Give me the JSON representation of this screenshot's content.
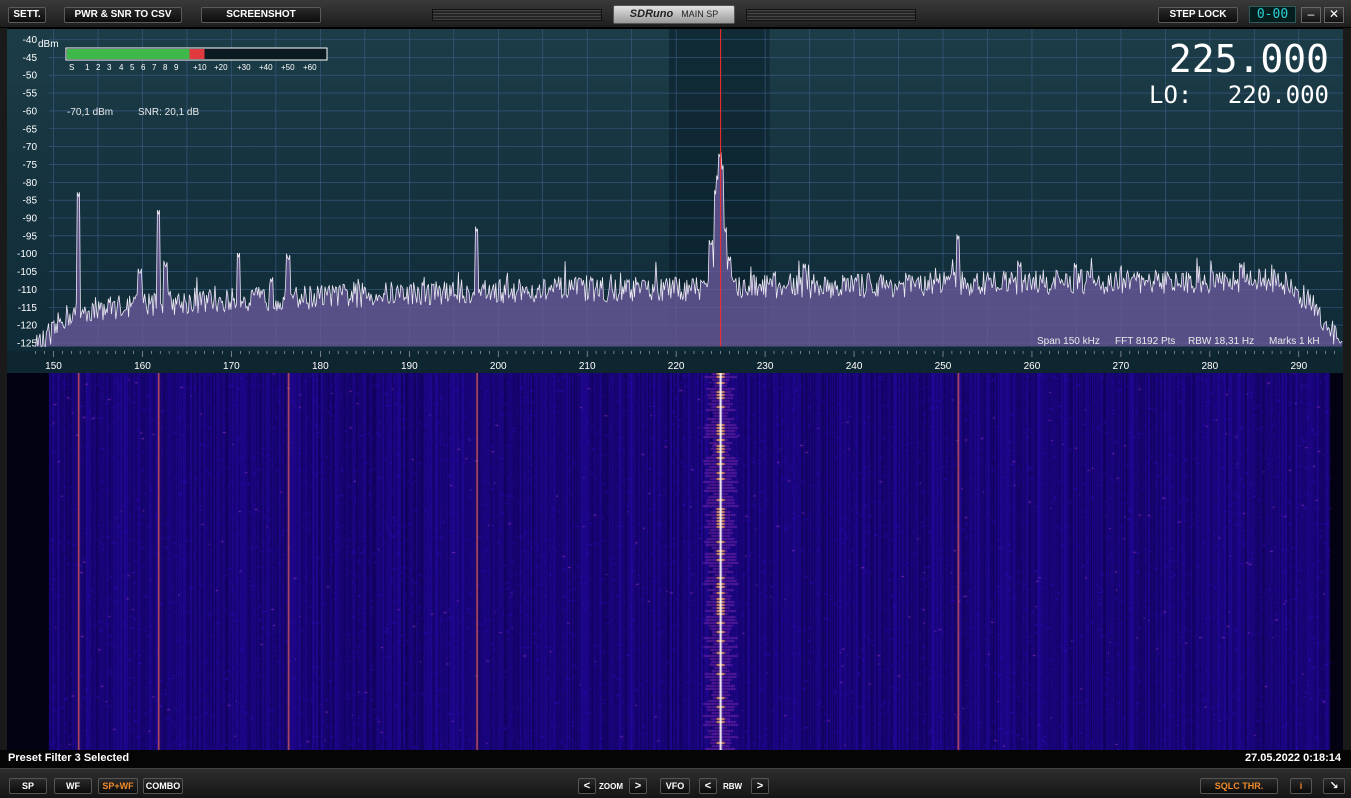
{
  "toolbar": {
    "sett": "SETT.",
    "csv": "PWR & SNR TO CSV",
    "screenshot": "SCREENSHOT",
    "brand": "SDRuno",
    "window_name": "MAIN SP",
    "step_lock": "STEP LOCK",
    "clock": "0-00",
    "minimize": "–",
    "close": "✕"
  },
  "readout": {
    "freq": "225.000",
    "lo_label": "LO:",
    "lo_value": "220.000",
    "power": "-70,1 dBm",
    "snr": "SNR: 20,1 dB",
    "dbm_label": "dBm",
    "smeter_labels": [
      "S",
      "1",
      "2",
      "3",
      "4",
      "5",
      "6",
      "7",
      "8",
      "9",
      "+10",
      "+20",
      "+30",
      "+40",
      "+50",
      "+60"
    ],
    "smeter_level_fraction": 0.55
  },
  "status": {
    "span": "Span 150 kHz",
    "fft": "FFT 8192 Pts",
    "rbw": "RBW 18,31 Hz",
    "marks": "Marks 1 kH"
  },
  "footer": {
    "left": "Preset Filter 3 Selected",
    "right": "27.05.2022 0:18:14"
  },
  "bottom": {
    "sp": "SP",
    "wf": "WF",
    "spwf": "SP+WF",
    "combo": "COMBO",
    "prev": "<",
    "next": ">",
    "zoom": "ZOOM",
    "vfo": "VFO",
    "rbw": "RBW",
    "sqlc": "SQLC THR.",
    "info": "i",
    "resize": "↘"
  },
  "colors": {
    "accent_orange": "#f08a2a",
    "cursor_red": "#ff2a2a",
    "clock_cyan": "#29d3d3",
    "trace": "#e8e4f0",
    "fill": "#7060a0"
  },
  "chart_data": {
    "type": "line",
    "xlabel": "",
    "ylabel": "dBm",
    "xlim": [
      148,
      295
    ],
    "ylim": [
      -126,
      -39
    ],
    "xticks": [
      150,
      160,
      170,
      180,
      190,
      200,
      210,
      220,
      230,
      240,
      250,
      260,
      270,
      280,
      290
    ],
    "yticks": [
      -40,
      -45,
      -50,
      -55,
      -60,
      -65,
      -70,
      -75,
      -80,
      -85,
      -90,
      -95,
      -100,
      -105,
      -110,
      -115,
      -120,
      -125
    ],
    "center_freq": 225,
    "passband": [
      219.2,
      230.5
    ],
    "baseline": [
      [
        148,
        -126
      ],
      [
        149.5,
        -124
      ],
      [
        151,
        -118
      ],
      [
        153,
        -116
      ],
      [
        160,
        -114
      ],
      [
        170,
        -113
      ],
      [
        180,
        -112
      ],
      [
        190,
        -111
      ],
      [
        200,
        -110.5
      ],
      [
        210,
        -110
      ],
      [
        220,
        -110
      ],
      [
        230,
        -109
      ],
      [
        240,
        -109
      ],
      [
        250,
        -108.5
      ],
      [
        260,
        -108
      ],
      [
        270,
        -108
      ],
      [
        280,
        -108
      ],
      [
        285,
        -107
      ],
      [
        288,
        -108
      ],
      [
        291,
        -113
      ],
      [
        293,
        -119
      ],
      [
        295,
        -126
      ]
    ],
    "peaks": [
      {
        "x": 152.8,
        "y": -84
      },
      {
        "x": 156.3,
        "y": -114
      },
      {
        "x": 159.7,
        "y": -106
      },
      {
        "x": 161.8,
        "y": -89
      },
      {
        "x": 162.6,
        "y": -104
      },
      {
        "x": 170.8,
        "y": -101
      },
      {
        "x": 174.5,
        "y": -108
      },
      {
        "x": 176.4,
        "y": -102
      },
      {
        "x": 197.6,
        "y": -94
      },
      {
        "x": 223.9,
        "y": -98
      },
      {
        "x": 224.5,
        "y": -84
      },
      {
        "x": 224.75,
        "y": -80
      },
      {
        "x": 224.9,
        "y": -73
      },
      {
        "x": 225.1,
        "y": -77
      },
      {
        "x": 225.5,
        "y": -94
      },
      {
        "x": 226.0,
        "y": -102
      },
      {
        "x": 234.4,
        "y": -104
      },
      {
        "x": 251.7,
        "y": -96
      },
      {
        "x": 258.6,
        "y": -104
      },
      {
        "x": 264.9,
        "y": -104
      },
      {
        "x": 283.5,
        "y": -104
      }
    ],
    "waterfall_carriers": [
      152.8,
      161.8,
      176.4,
      197.6,
      251.7
    ]
  }
}
